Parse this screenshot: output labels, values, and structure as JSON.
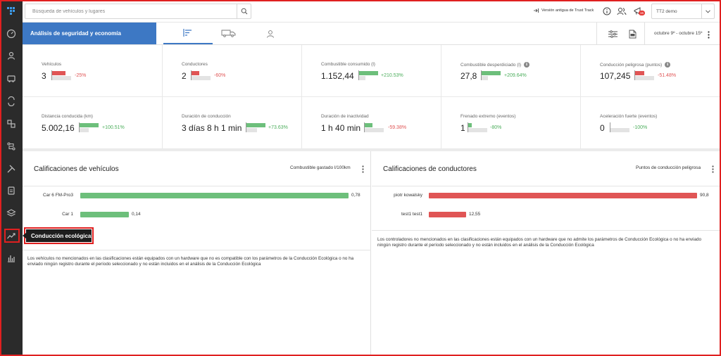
{
  "search": {
    "placeholder": "Búsqueda de vehículos y lugares"
  },
  "topbar": {
    "old_version_label": "Versión antigua de Trust Track",
    "notification_count": "15",
    "account_name": "TT2 demo"
  },
  "section": {
    "title": "Análisis de seguridad y economía",
    "date_range": "octubre 9º - octubre 15º"
  },
  "kpis": [
    {
      "label": "Vehículos",
      "value": "3",
      "change": "-25%",
      "trend": "neg",
      "info": false
    },
    {
      "label": "Conductores",
      "value": "2",
      "change": "-60%",
      "trend": "neg",
      "info": false
    },
    {
      "label": "Combustible consumido (l)",
      "value": "1.152,44",
      "change": "+210.53%",
      "trend": "pos",
      "info": false
    },
    {
      "label": "Combustible desperdiciado (l)",
      "value": "27,8",
      "change": "+209.64%",
      "trend": "pos",
      "info": true
    },
    {
      "label": "Conducción peligrosa (puntos)",
      "value": "107,245",
      "change": "-51.48%",
      "trend": "neg",
      "info": true
    },
    {
      "label": "Distancia conducida (km)",
      "value": "5.002,16",
      "change": "+100.51%",
      "trend": "pos",
      "info": false
    },
    {
      "label": "Duración de conducción",
      "value": "3 días 8 h 1 min",
      "change": "+73.63%",
      "trend": "pos",
      "info": false
    },
    {
      "label": "Duración de inactividad",
      "value": "1 h 40 min",
      "change": "-59.38%",
      "trend": "pos",
      "info": false
    },
    {
      "label": "Frenado extremo (eventos)",
      "value": "1",
      "change": "-80%",
      "trend": "pos",
      "info": false
    },
    {
      "label": "Aceleración fuerte (eventos)",
      "value": "0",
      "change": "-100%",
      "trend": "pos",
      "info": false
    }
  ],
  "vehicles_panel": {
    "title": "Calificaciones de vehículos",
    "metric": "Combustible gastado l/100km",
    "rows": [
      {
        "name": "Car 6 FM-Pro3",
        "value": "0,78",
        "fraction": 1.0
      },
      {
        "name": "Car 1",
        "value": "0,14",
        "fraction": 0.18
      }
    ],
    "note": "Los vehículos no mencionados en las clasificaciones están equipados con un hardware que no es compatible con los parámetros de la Conducción Ecológica o no ha enviado ningún registro durante el período seleccionado y no están incluidos en el análisis de la Conducción Ecológica"
  },
  "drivers_panel": {
    "title": "Calificaciones de conductores",
    "metric": "Puntos de conducción peligrosa",
    "rows": [
      {
        "name": "piotr kowalsky",
        "value": "90,8",
        "fraction": 1.0
      },
      {
        "name": "test1 test1",
        "value": "12,55",
        "fraction": 0.14
      }
    ],
    "note": "Los controladores no mencionados en las clasificaciones están equipados con un hardware que no admite los parámetros de Conducción Ecológica o no ha enviado ningún registro durante el período seleccionado y no están incluidos en el análisis de la Conducción Ecológica"
  },
  "tooltip": {
    "label": "Conducción ecológica"
  },
  "colors": {
    "accent": "#3d78c4",
    "positive": "#6dbf7b",
    "negative": "#e05555",
    "sidebar": "#2b2b2b"
  }
}
